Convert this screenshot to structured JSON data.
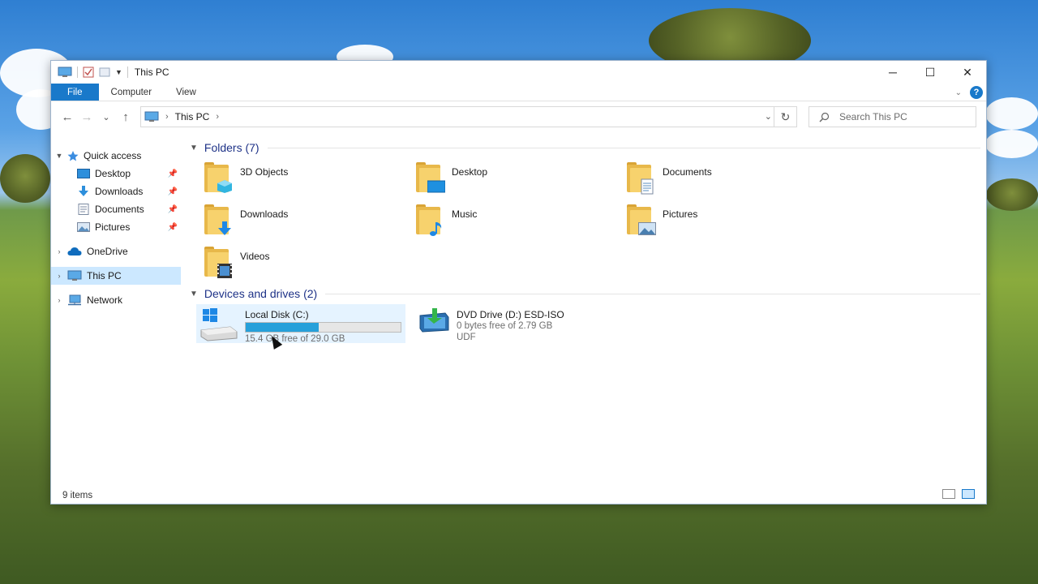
{
  "window": {
    "title": "This PC",
    "caption": {
      "minimize": "─",
      "maximize": "☐",
      "close": "✕"
    }
  },
  "ribbon": {
    "tabs": [
      {
        "label": "File",
        "active": true
      },
      {
        "label": "Computer",
        "active": false
      },
      {
        "label": "View",
        "active": false
      }
    ],
    "help": "?",
    "colors": {
      "file_tab": "#1979ca"
    }
  },
  "navigation": {
    "back": "←",
    "forward": "→",
    "recent": "⌄",
    "up": "↑",
    "address": {
      "crumbs": [
        "This PC"
      ],
      "dropdown": "⌄",
      "refresh": "↻"
    },
    "search": {
      "placeholder": "Search This PC",
      "icon": "search-icon"
    }
  },
  "sidebar": {
    "items": [
      {
        "label": "Quick access",
        "icon": "star-icon",
        "expander": "⌄",
        "level": 0
      },
      {
        "label": "Desktop",
        "icon": "desktop-folder-icon",
        "pinned": true,
        "level": 1
      },
      {
        "label": "Downloads",
        "icon": "downloads-arrow-icon",
        "pinned": true,
        "level": 1
      },
      {
        "label": "Documents",
        "icon": "documents-icon",
        "pinned": true,
        "level": 1
      },
      {
        "label": "Pictures",
        "icon": "pictures-icon",
        "pinned": true,
        "level": 1
      },
      {
        "label": "OneDrive",
        "icon": "onedrive-cloud-icon",
        "expander": ">",
        "level": 0
      },
      {
        "label": "This PC",
        "icon": "computer-icon",
        "expander": ">",
        "level": 0,
        "selected": true
      },
      {
        "label": "Network",
        "icon": "network-icon",
        "expander": ">",
        "level": 0
      }
    ]
  },
  "content": {
    "folders_group": {
      "label": "Folders (7)",
      "chevron": "⌄"
    },
    "folders": [
      {
        "label": "3D Objects",
        "icon": "3d-objects-icon"
      },
      {
        "label": "Desktop",
        "icon": "desktop-icon"
      },
      {
        "label": "Documents",
        "icon": "documents-folder-icon"
      },
      {
        "label": "Downloads",
        "icon": "downloads-folder-icon"
      },
      {
        "label": "Music",
        "icon": "music-folder-icon"
      },
      {
        "label": "Pictures",
        "icon": "pictures-folder-icon"
      },
      {
        "label": "Videos",
        "icon": "videos-folder-icon"
      }
    ],
    "drives_group": {
      "label": "Devices and drives (2)",
      "chevron": "⌄"
    },
    "drives": [
      {
        "label": "Local Disk (C:)",
        "free_text": "15.4 GB free of 29.0 GB",
        "used_fraction": 0.47,
        "icon": "windows-drive-icon",
        "selected": true
      },
      {
        "label": "DVD Drive (D:) ESD-ISO",
        "free_text": "0 bytes free of 2.79 GB",
        "filesystem": "UDF",
        "icon": "dvd-drive-icon"
      }
    ]
  },
  "status": {
    "items_count": "9 items"
  }
}
